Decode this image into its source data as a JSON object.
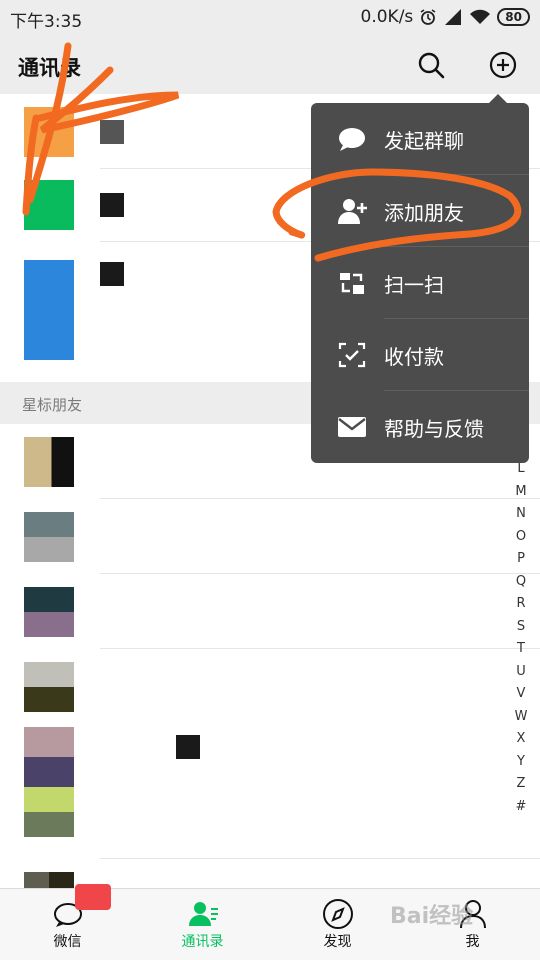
{
  "status_bar": {
    "time": "下午3:35",
    "speed": "0.0K/s",
    "battery": "80"
  },
  "header": {
    "title": "通讯录"
  },
  "section": {
    "starred": "星标朋友"
  },
  "index_letters": [
    "L",
    "M",
    "N",
    "O",
    "P",
    "Q",
    "R",
    "S",
    "T",
    "U",
    "V",
    "W",
    "X",
    "Y",
    "Z",
    "#"
  ],
  "menu": {
    "items": [
      {
        "label": "发起群聊",
        "icon": "chat-bubble-icon"
      },
      {
        "label": "添加朋友",
        "icon": "add-friend-icon"
      },
      {
        "label": "扫一扫",
        "icon": "scan-icon"
      },
      {
        "label": "收付款",
        "icon": "payment-icon"
      },
      {
        "label": "帮助与反馈",
        "icon": "mail-icon"
      }
    ]
  },
  "tabs": [
    {
      "label": "微信",
      "icon": "chat-icon"
    },
    {
      "label": "通讯录",
      "icon": "contacts-icon",
      "active": true
    },
    {
      "label": "发现",
      "icon": "compass-icon"
    },
    {
      "label": "我",
      "icon": "person-icon"
    }
  ],
  "colors": {
    "accent": "#07c160",
    "menu_bg": "#4c4c4c",
    "annotation": "#f26a21"
  },
  "watermark": "Bai经验"
}
